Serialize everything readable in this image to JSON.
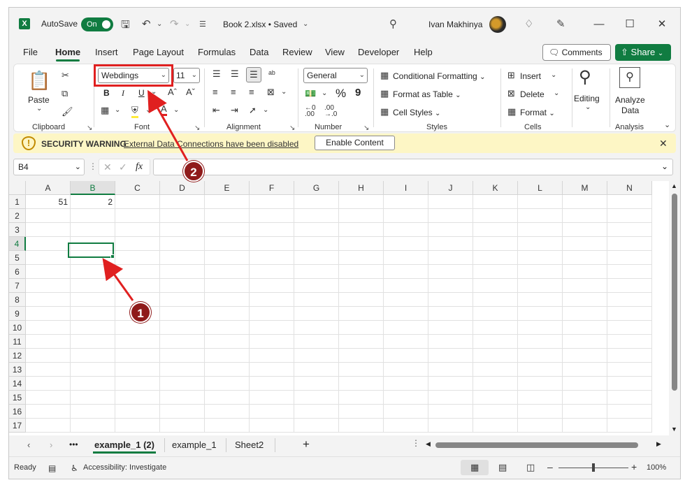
{
  "titlebar": {
    "app_icon": "X",
    "autosave_label": "AutoSave",
    "autosave_state": "On",
    "document_title": "Book 2.xlsx • Saved",
    "user_name": "Ivan Makhinya"
  },
  "menu": {
    "tabs": [
      "File",
      "Home",
      "Insert",
      "Page Layout",
      "Formulas",
      "Data",
      "Review",
      "View",
      "Developer",
      "Help"
    ],
    "active": "Home",
    "comments_label": "Comments",
    "share_label": "Share"
  },
  "ribbon": {
    "clipboard": {
      "paste_label": "Paste",
      "group_label": "Clipboard"
    },
    "font": {
      "font_name": "Webdings",
      "font_size": "11",
      "group_label": "Font",
      "bold": "B",
      "italic": "I",
      "underline": "U"
    },
    "alignment": {
      "group_label": "Alignment"
    },
    "number": {
      "format": "General",
      "percent": "%",
      "comma": "9",
      "group_label": "Number"
    },
    "styles": {
      "conditional": "Conditional Formatting",
      "format_table": "Format as Table",
      "cell_styles": "Cell Styles",
      "group_label": "Styles"
    },
    "cells": {
      "insert": "Insert",
      "delete": "Delete",
      "format": "Format",
      "group_label": "Cells"
    },
    "editing": {
      "label": "Editing"
    },
    "analysis": {
      "analyze_line1": "Analyze",
      "analyze_line2": "Data",
      "group_label": "Analysis"
    }
  },
  "security": {
    "title": "SECURITY WARNING",
    "message": "External Data Connections have been disabled",
    "button": "Enable Content"
  },
  "formula_bar": {
    "name_box": "B4",
    "fx": "fx",
    "value": ""
  },
  "grid": {
    "columns": [
      "A",
      "B",
      "C",
      "D",
      "E",
      "F",
      "G",
      "H",
      "I",
      "J",
      "K",
      "L",
      "M",
      "N"
    ],
    "rows": [
      "1",
      "2",
      "3",
      "4",
      "5",
      "6",
      "7",
      "8",
      "9",
      "10",
      "11",
      "12",
      "13",
      "14",
      "15",
      "16",
      "17"
    ],
    "cells": {
      "A1": "51",
      "B1": "2"
    },
    "selected": "B4"
  },
  "sheets": {
    "tabs": [
      "example_1 (2)",
      "example_1",
      "Sheet2"
    ],
    "active": "example_1 (2)",
    "more": "•••",
    "add": "+"
  },
  "status": {
    "ready": "Ready",
    "accessibility": "Accessibility: Investigate",
    "zoom": "100%",
    "zoom_level": 1.0
  },
  "annotations": {
    "marker_1": "1",
    "marker_2": "2"
  },
  "colors": {
    "excel_green": "#107c41",
    "annotation_red": "#e02020",
    "marker_fill": "#8f1b1b",
    "warning_bg": "#fdf6c5"
  },
  "icons": [
    "excel-icon",
    "save-icon",
    "undo-icon",
    "redo-icon",
    "search-icon",
    "diamond-icon",
    "pen-icon",
    "minimize-icon",
    "maximize-icon",
    "close-icon",
    "cut-icon",
    "copy-icon",
    "format-painter-icon",
    "shield-warning-icon",
    "zoom-icon"
  ]
}
